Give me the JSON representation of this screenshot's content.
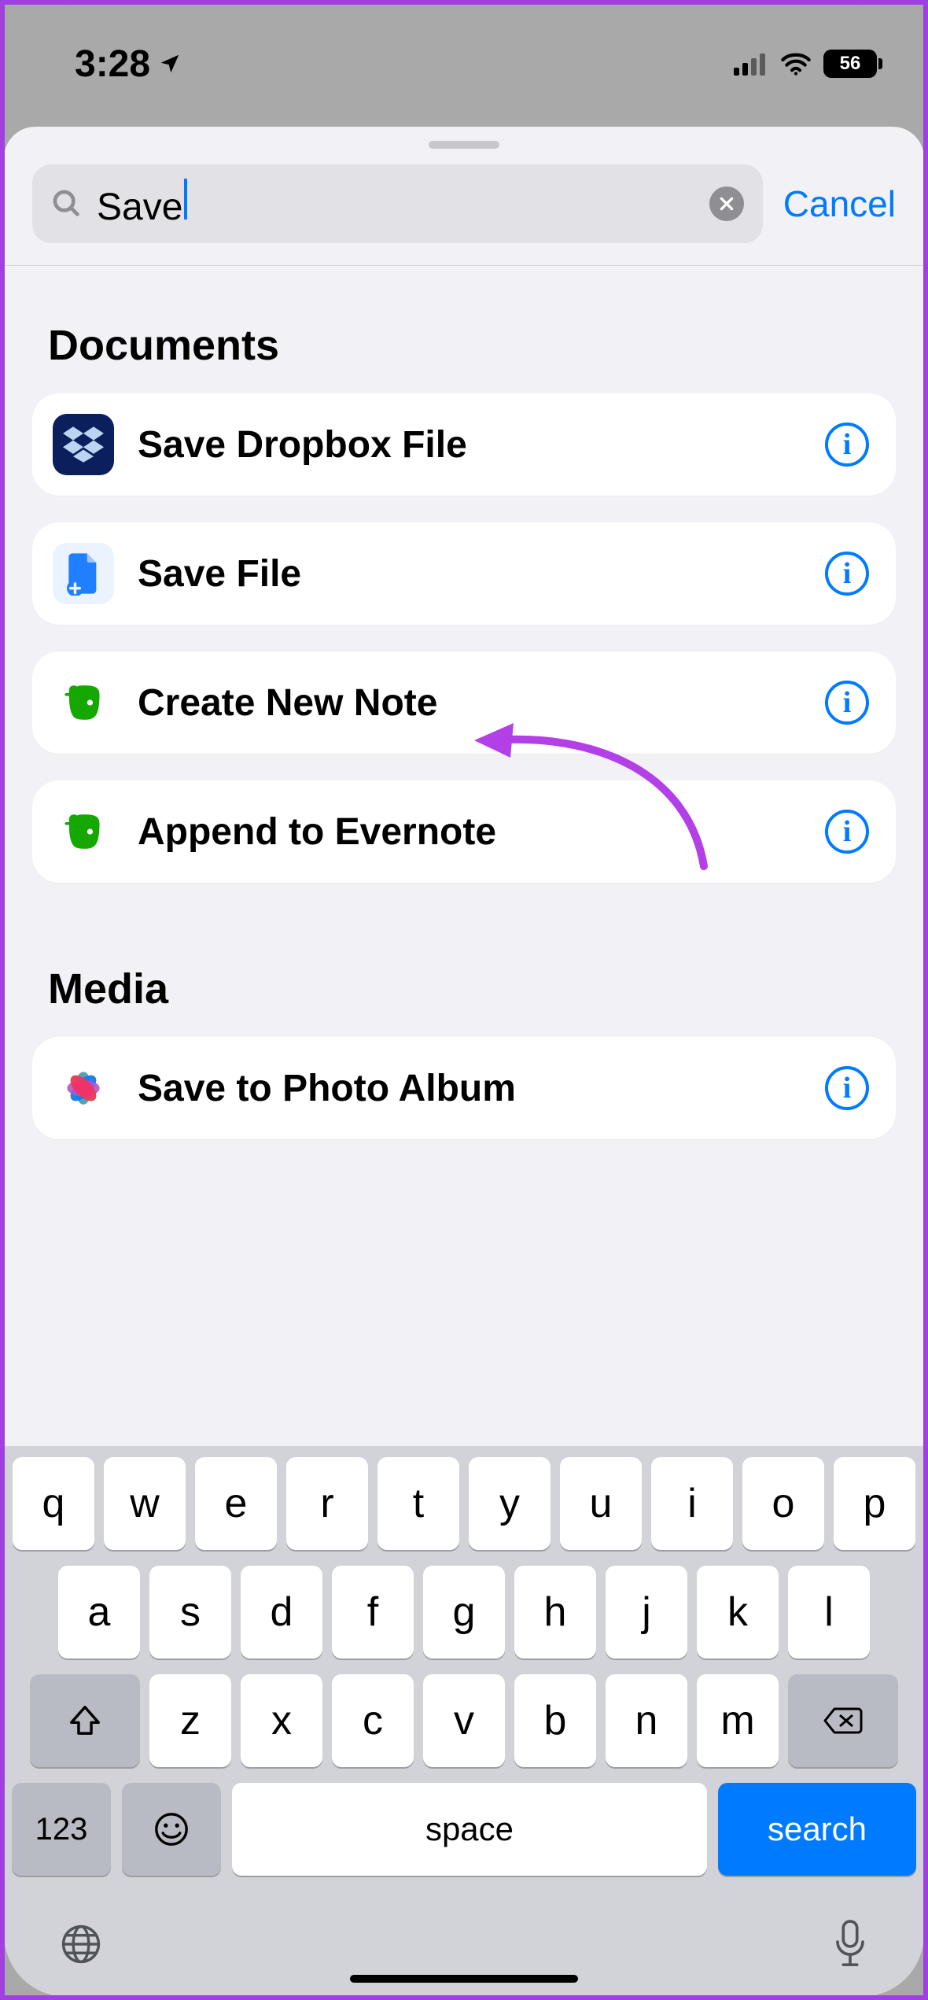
{
  "statusbar": {
    "time": "3:28",
    "battery": "56"
  },
  "search": {
    "value": "Save",
    "cancel_label": "Cancel"
  },
  "sections": {
    "documents": {
      "title": "Documents",
      "items": [
        {
          "label": "Save Dropbox File"
        },
        {
          "label": "Save File"
        },
        {
          "label": "Create New Note"
        },
        {
          "label": "Append to Evernote"
        }
      ]
    },
    "media": {
      "title": "Media",
      "items": [
        {
          "label": "Save to Photo Album"
        }
      ]
    }
  },
  "keyboard": {
    "row1": [
      "q",
      "w",
      "e",
      "r",
      "t",
      "y",
      "u",
      "i",
      "o",
      "p"
    ],
    "row2": [
      "a",
      "s",
      "d",
      "f",
      "g",
      "h",
      "j",
      "k",
      "l"
    ],
    "row3": [
      "z",
      "x",
      "c",
      "v",
      "b",
      "n",
      "m"
    ],
    "numeric_label": "123",
    "space_label": "space",
    "search_label": "search"
  }
}
